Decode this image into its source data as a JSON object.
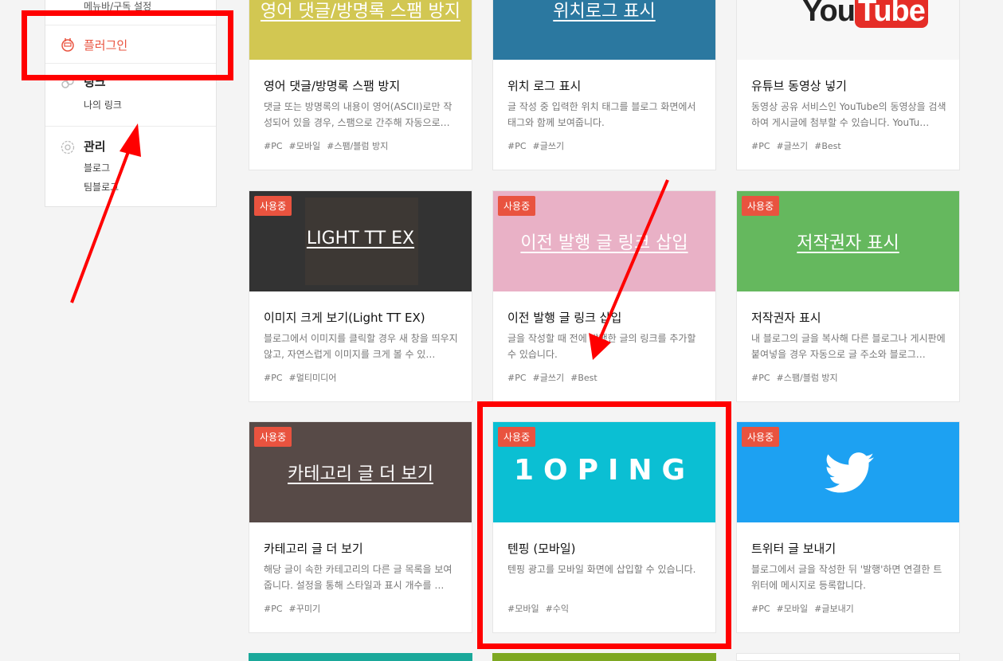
{
  "sidebar": {
    "top_sub": "메뉴바/구독 설정",
    "plugin_label": "플러그인",
    "link_label": "링크",
    "link_sub": "나의 링크",
    "manage_label": "관리",
    "manage_sub1": "블로그",
    "manage_sub2": "팀블로그"
  },
  "cards": [
    {
      "thumb_title": "영어 댓글/방명록 스팸 방지",
      "badge": "",
      "name": "영어 댓글/방명록 스팸 방지",
      "desc": "댓글 또는 방명록의 내용이 영어(ASCII)로만 작성되어 있을 경우, 스팸으로 간주해 자동으로…",
      "tags": [
        "#PC",
        "#모바일",
        "#스팸/블럼 방지"
      ],
      "color": "#d2c752"
    },
    {
      "thumb_title": "위치로그 표시",
      "badge": "",
      "name": "위치 로그 표시",
      "desc": "글 작성 중 입력한 위치 태그를 블로그 화면에서 태그와 함께 보여줍니다.",
      "tags": [
        "#PC",
        "#글쓰기"
      ],
      "color": "#2b78a0"
    },
    {
      "thumb_title": "",
      "badge": "",
      "name": "유튜브 동영상 넣기",
      "desc": "동영상 공유 서비스인 YouTube의 동영상을 검색하여 게시글에 첨부할 수 있습니다. YouTu…",
      "tags": [
        "#PC",
        "#글쓰기",
        "#Best"
      ],
      "color": "#f7f7f7",
      "logo_text": "You",
      "logo_tube": "Tube"
    },
    {
      "thumb_title": "LIGHT TT EX",
      "badge": "사용중",
      "name": "이미지 크게 보기(Light TT EX)",
      "desc": "블로그에서 이미지를 클릭할 경우 새 창을 띄우지 않고, 자연스럽게 이미지를 크게 볼 수 있…",
      "tags": [
        "#PC",
        "#멀티미디어"
      ],
      "color": "#333333"
    },
    {
      "thumb_title": "이전 발행 글 링크 삽입",
      "badge": "사용중",
      "name": "이전 발행 글 링크 삽입",
      "desc": "글을 작성할 때 전에 발행한 글의 링크를 추가할 수 있습니다.",
      "tags": [
        "#PC",
        "#글쓰기",
        "#Best"
      ],
      "color": "#e9b1c6"
    },
    {
      "thumb_title": "저작권자 표시",
      "badge": "사용중",
      "name": "저작권자 표시",
      "desc": "내 블로그의 글을 복사해 다른 블로그나 게시판에 붙여넣을 경우 자동으로 글 주소와 블로그…",
      "tags": [
        "#PC",
        "#스팸/블럼 방지"
      ],
      "color": "#65b85e"
    },
    {
      "thumb_title": "카테고리 글 더 보기",
      "badge": "사용중",
      "name": "카테고리 글 더 보기",
      "desc": "해당 글이 속한 카테고리의 다른 글 목록을 보여줍니다. 설정을 통해 스타일과 표시 개수를 …",
      "tags": [
        "#PC",
        "#꾸미기"
      ],
      "color": "#574a47"
    },
    {
      "thumb_title": "",
      "badge": "사용중",
      "name": "텐핑 (모바일)",
      "desc": "텐핑 광고를 모바일 화면에 삽입할 수 있습니다.",
      "tags": [
        "#모바일",
        "#수익"
      ],
      "color": "#0bbfd3",
      "logo_text": "1OPING"
    },
    {
      "thumb_title": "",
      "badge": "사용중",
      "name": "트위터 글 보내기",
      "desc": "블로그에서 글을 작성한 뒤 '발행'하면 연결한 트위터에 메시지로 등록합니다.",
      "tags": [
        "#PC",
        "#모바일",
        "#글보내기"
      ],
      "color": "#1da1f2"
    }
  ]
}
